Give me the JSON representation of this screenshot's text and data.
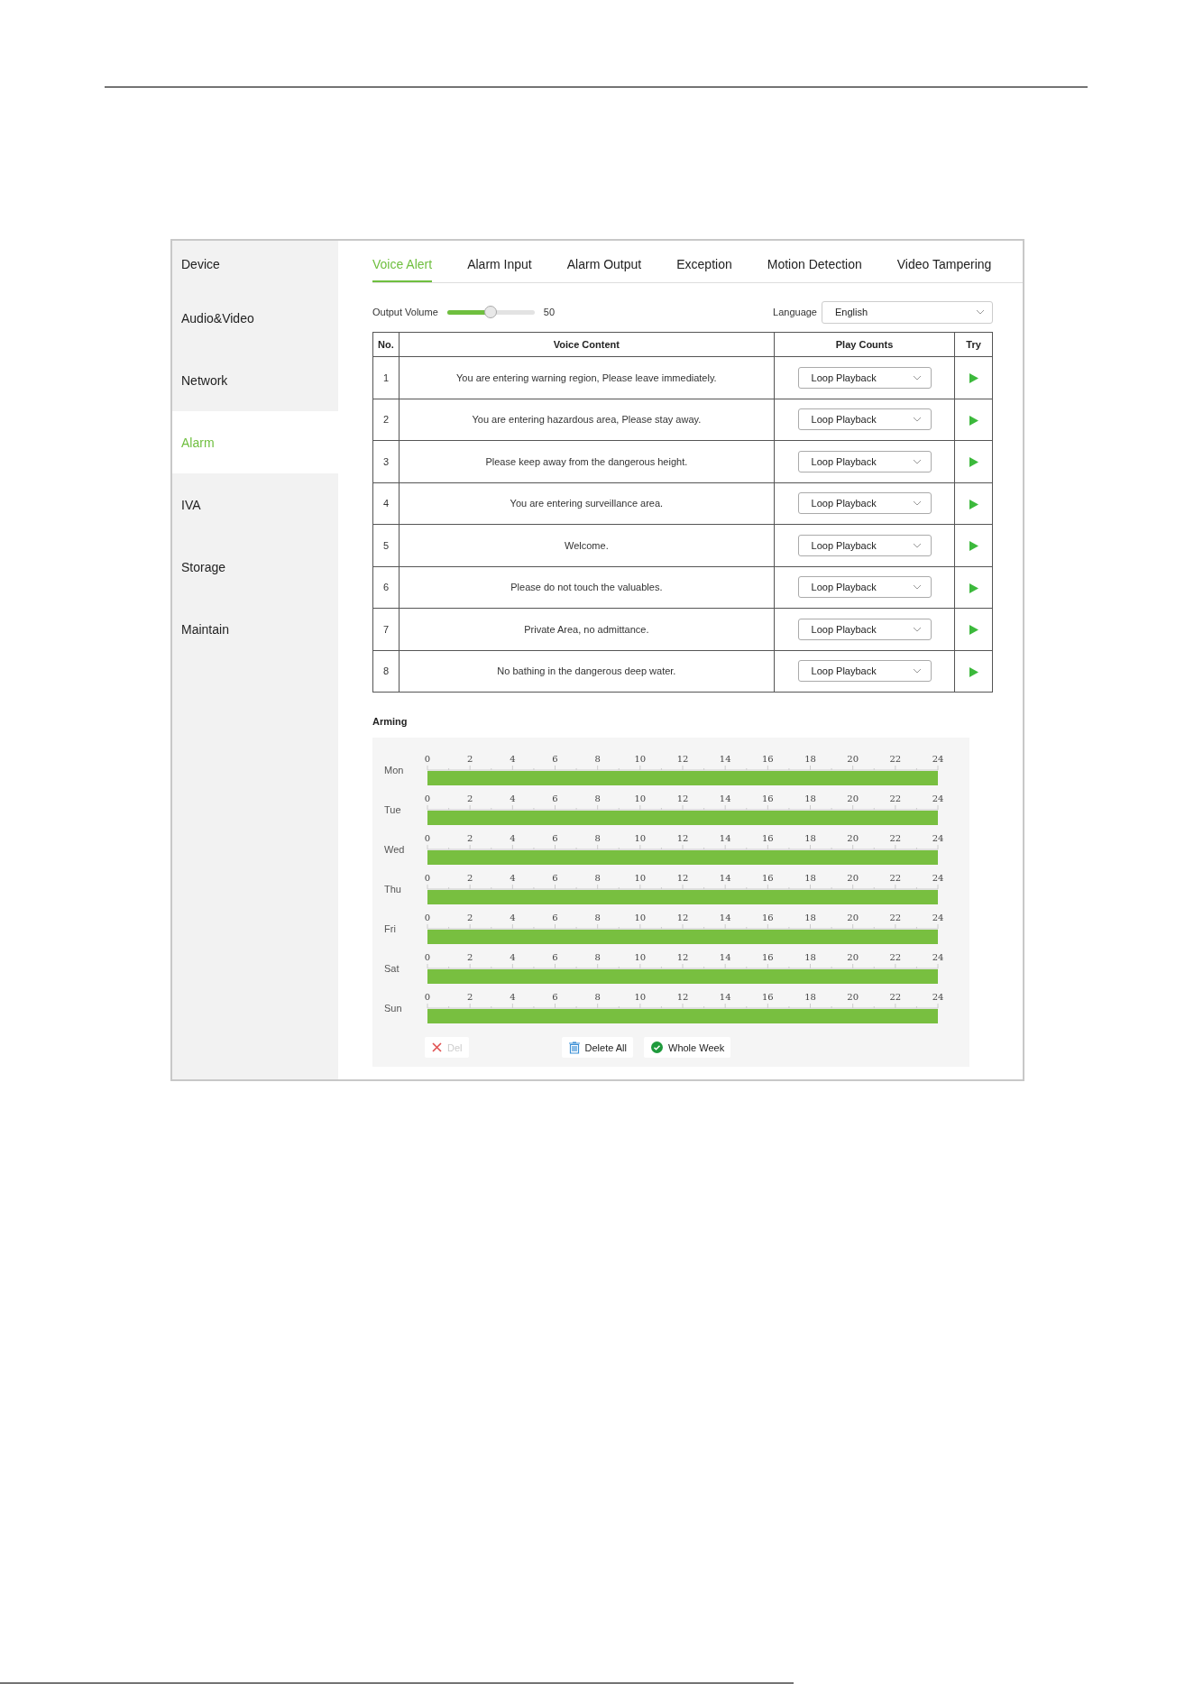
{
  "sidebar": {
    "items": [
      {
        "label": "Device",
        "selected": false
      },
      {
        "label": "Audio&Video",
        "selected": false
      },
      {
        "label": "Network",
        "selected": false
      },
      {
        "label": "Alarm",
        "selected": true
      },
      {
        "label": "IVA",
        "selected": false
      },
      {
        "label": "Storage",
        "selected": false
      },
      {
        "label": "Maintain",
        "selected": false
      }
    ]
  },
  "tabs": [
    {
      "label": "Voice Alert",
      "selected": true
    },
    {
      "label": "Alarm Input",
      "selected": false
    },
    {
      "label": "Alarm Output",
      "selected": false
    },
    {
      "label": "Exception",
      "selected": false
    },
    {
      "label": "Motion Detection",
      "selected": false
    },
    {
      "label": "Video Tampering",
      "selected": false
    }
  ],
  "output_volume": {
    "label": "Output Volume",
    "level": 0.5,
    "reading": "50"
  },
  "language": {
    "label": "Language",
    "value": "English"
  },
  "table": {
    "columns": [
      "No.",
      "Voice Content",
      "Play Counts",
      "Try"
    ],
    "rows": [
      {
        "no": "1",
        "content": "You are entering warning region, Please leave immediately.",
        "play_counts": "Loop Playback"
      },
      {
        "no": "2",
        "content": "You are entering hazardous area, Please stay away.",
        "play_counts": "Loop Playback"
      },
      {
        "no": "3",
        "content": "Please keep away from the dangerous height.",
        "play_counts": "Loop Playback"
      },
      {
        "no": "4",
        "content": "You are entering surveillance area.",
        "play_counts": "Loop Playback"
      },
      {
        "no": "5",
        "content": "Welcome.",
        "play_counts": "Loop Playback"
      },
      {
        "no": "6",
        "content": "Please do not touch the valuables.",
        "play_counts": "Loop Playback"
      },
      {
        "no": "7",
        "content": "Private Area, no admittance.",
        "play_counts": "Loop Playback"
      },
      {
        "no": "8",
        "content": "No bathing in the dangerous deep water.",
        "play_counts": "Loop Playback"
      }
    ]
  },
  "arming": {
    "title": "Arming",
    "days": [
      {
        "day": "Mon",
        "level": 1,
        "hours": [
          "0",
          "2",
          "4",
          "6",
          "8",
          "10",
          "12",
          "14",
          "16",
          "18",
          "20",
          "22",
          "24"
        ]
      },
      {
        "day": "Tue",
        "level": 1,
        "hours": [
          "0",
          "2",
          "4",
          "6",
          "8",
          "10",
          "12",
          "14",
          "16",
          "18",
          "20",
          "22",
          "24"
        ]
      },
      {
        "day": "Wed",
        "level": 1,
        "hours": [
          "0",
          "2",
          "4",
          "6",
          "8",
          "10",
          "12",
          "14",
          "16",
          "18",
          "20",
          "22",
          "24"
        ]
      },
      {
        "day": "Thu",
        "level": 1,
        "hours": [
          "0",
          "2",
          "4",
          "6",
          "8",
          "10",
          "12",
          "14",
          "16",
          "18",
          "20",
          "22",
          "24"
        ]
      },
      {
        "day": "Fri",
        "level": 1,
        "hours": [
          "0",
          "2",
          "4",
          "6",
          "8",
          "10",
          "12",
          "14",
          "16",
          "18",
          "20",
          "22",
          "24"
        ]
      },
      {
        "day": "Sat",
        "level": 1,
        "hours": [
          "0",
          "2",
          "4",
          "6",
          "8",
          "10",
          "12",
          "14",
          "16",
          "18",
          "20",
          "22",
          "24"
        ]
      },
      {
        "day": "Sun",
        "level": 1,
        "hours": [
          "0",
          "2",
          "4",
          "6",
          "8",
          "10",
          "12",
          "14",
          "16",
          "18",
          "20",
          "22",
          "24"
        ]
      }
    ],
    "buttons": [
      {
        "kind": "delete",
        "label": "Del",
        "disabled": true
      },
      {
        "kind": "delete_all",
        "label": "Delete All",
        "disabled": false
      },
      {
        "kind": "whole_week",
        "label": "Whole Week",
        "disabled": false
      }
    ]
  }
}
